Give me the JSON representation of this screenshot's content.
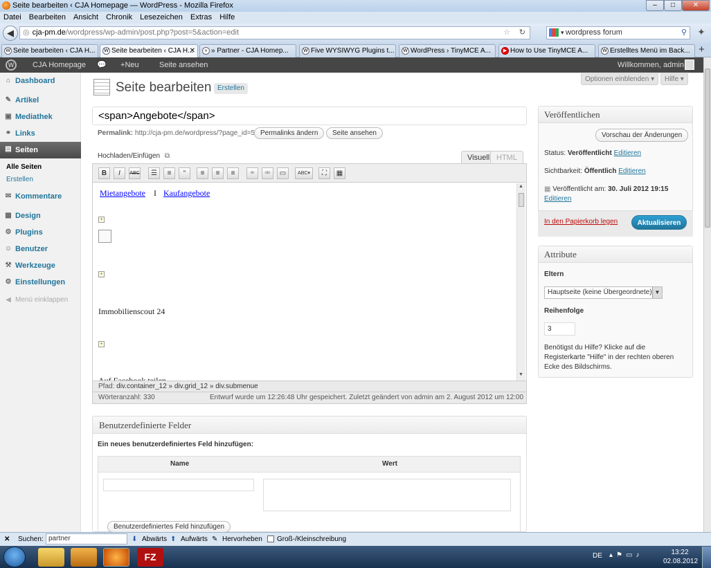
{
  "window": {
    "title": "Seite bearbeiten ‹ CJA Homepage — WordPress - Mozilla Firefox"
  },
  "menu": [
    "Datei",
    "Bearbeiten",
    "Ansicht",
    "Chronik",
    "Lesezeichen",
    "Extras",
    "Hilfe"
  ],
  "url": {
    "domain": "cja-pm.de",
    "path": "/wordpress/wp-admin/post.php?post=5&action=edit"
  },
  "search": {
    "value": "wordpress forum"
  },
  "tabs": [
    {
      "label": "Seite bearbeiten ‹ CJA H..."
    },
    {
      "label": "Seite bearbeiten ‹ CJA H..."
    },
    {
      "label": "» Partner - CJA Homep..."
    },
    {
      "label": "Five WYSIWYG Plugins t..."
    },
    {
      "label": "WordPress › TinyMCE A..."
    },
    {
      "label": "How to Use TinyMCE A..."
    },
    {
      "label": "Erstelltes Menü im Back..."
    }
  ],
  "adminbar": {
    "site": "CJA Homepage",
    "new": "Neu",
    "view": "Seite ansehen",
    "welcome": "Willkommen, admin"
  },
  "sidebar": {
    "items": [
      {
        "label": "Dashboard",
        "icon": "house-icon"
      },
      {
        "label": "Artikel",
        "icon": "pin-icon"
      },
      {
        "label": "Mediathek",
        "icon": "media-icon"
      },
      {
        "label": "Links",
        "icon": "link-icon"
      },
      {
        "label": "Seiten",
        "icon": "pages-icon"
      },
      {
        "label": "Kommentare",
        "icon": "comment-icon"
      },
      {
        "label": "Design",
        "icon": "design-icon"
      },
      {
        "label": "Plugins",
        "icon": "plugin-icon"
      },
      {
        "label": "Benutzer",
        "icon": "users-icon"
      },
      {
        "label": "Werkzeuge",
        "icon": "tools-icon"
      },
      {
        "label": "Einstellungen",
        "icon": "settings-icon"
      }
    ],
    "sub": [
      "Alle Seiten",
      "Erstellen"
    ],
    "collapse": "Menü einklappen"
  },
  "header": {
    "title": "Seite bearbeiten",
    "add_new": "Erstellen",
    "screen_options": "Optionen einblenden ▾",
    "help": "Hilfe ▾"
  },
  "post": {
    "title": "<span>Angebote</span>",
    "permalink_label": "Permalink:",
    "permalink_url": "http://cja-pm.de/wordpress/?page_id=5",
    "change_permalink": "Permalinks ändern",
    "view_page": "Seite ansehen",
    "upload": "Hochladen/Einfügen",
    "tab_visual": "Visuell",
    "tab_html": "HTML"
  },
  "editor": {
    "link1": "Mietangebote",
    "sep": "I",
    "link2": "Kaufangebote",
    "text1": "Immobilienscout 24",
    "text2": "Auf Facebook teilen",
    "path_label": "Pfad:",
    "path": "div.container_12 » div.grid_12 » div.submenue",
    "wordcount": "Wörteranzahl: 330",
    "saved": "Entwurf wurde um 12:26:48 Uhr gespeichert. Zuletzt geändert von admin am 2. August 2012 um 12:00"
  },
  "custom_fields": {
    "title": "Benutzerdefinierte Felder",
    "subtitle": "Ein neues benutzerdefiniertes Feld hinzufügen:",
    "col_name": "Name",
    "col_value": "Wert",
    "add_button": "Benutzerdefiniertes Feld hinzufügen"
  },
  "publish": {
    "title": "Veröffentlichen",
    "preview": "Vorschau der Änderungen",
    "status_label": "Status:",
    "status": "Veröffentlicht",
    "edit": "Editieren",
    "visibility_label": "Sichtbarkeit:",
    "visibility": "Öffentlich",
    "published_label": "Veröffentlicht am:",
    "published_date": "30. Juli 2012 19:15",
    "trash": "In den Papierkorb legen",
    "update": "Aktualisieren"
  },
  "attributes": {
    "title": "Attribute",
    "parent_label": "Eltern",
    "parent_value": "Hauptseite (keine Übergeordnete)",
    "order_label": "Reihenfolge",
    "order_value": "3",
    "help": "Benötigst du Hilfe? Klicke auf die Registerkarte \"Hilfe\" in der rechten oberen Ecke des Bildschirms."
  },
  "findbar": {
    "label": "Suchen:",
    "value": "partner",
    "down": "Abwärts",
    "up": "Aufwärts",
    "highlight": "Hervorheben",
    "case": "Groß-/Kleinschreibung"
  },
  "taskbar": {
    "lang": "DE",
    "time": "13:22",
    "date": "02.08.2012"
  }
}
